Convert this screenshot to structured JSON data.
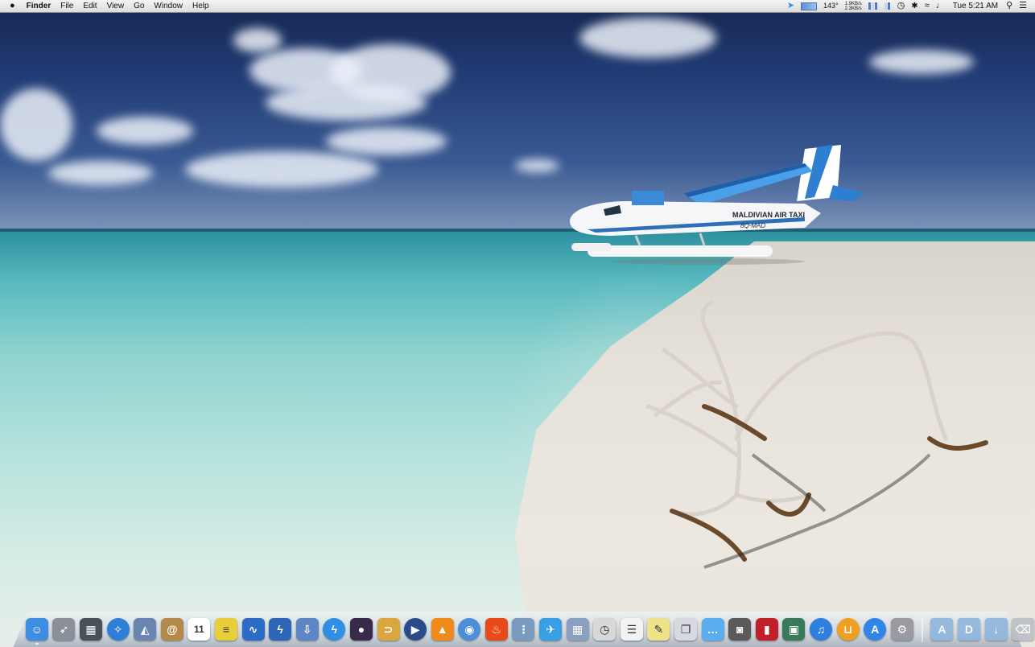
{
  "menubar": {
    "apple": "",
    "app_name": "Finder",
    "menus": [
      "File",
      "Edit",
      "View",
      "Go",
      "Window",
      "Help"
    ],
    "status": {
      "twitter_icon": "bird-icon",
      "temperature": "143°",
      "net_up": "1.9KB/s",
      "net_down": "2.3KB/s",
      "clock": "Tue 5:21 AM"
    }
  },
  "dock": {
    "apps": [
      {
        "name": "Finder",
        "icon": "finder-icon",
        "color": "#3d8de0"
      },
      {
        "name": "Launchpad",
        "icon": "rocket-icon",
        "color": "#8a8f99"
      },
      {
        "name": "Mission Control",
        "icon": "mission-control-icon",
        "color": "#4a5058"
      },
      {
        "name": "Safari",
        "icon": "compass-icon",
        "color": "#2f7fd8"
      },
      {
        "name": "Preview",
        "icon": "preview-icon",
        "color": "#6a86b0"
      },
      {
        "name": "Contacts",
        "icon": "address-book-icon",
        "color": "#b48a4a"
      },
      {
        "name": "Calendar",
        "icon": "calendar-icon",
        "color": "#ffffff",
        "label": "11"
      },
      {
        "name": "Stickies",
        "icon": "stickies-icon",
        "color": "#e8cf3a"
      },
      {
        "name": "Activity",
        "icon": "waveform-icon",
        "color": "#2c6cc9"
      },
      {
        "name": "Reeder",
        "icon": "lightning-bolt-icon",
        "color": "#2e66b8"
      },
      {
        "name": "Downloader",
        "icon": "download-tray-icon",
        "color": "#5f86c4"
      },
      {
        "name": "Sparrow",
        "icon": "bolt-circle-icon",
        "color": "#2f8fe6"
      },
      {
        "name": "Alfred",
        "icon": "bowler-hat-icon",
        "color": "#3a2a4a"
      },
      {
        "name": "Clipboard",
        "icon": "paperclip-icon",
        "color": "#d9a640"
      },
      {
        "name": "Media Player",
        "icon": "play-circle-icon",
        "color": "#2a4a8a"
      },
      {
        "name": "VLC",
        "icon": "traffic-cone-icon",
        "color": "#f08a1a"
      },
      {
        "name": "Chrome",
        "icon": "chrome-icon",
        "color": "#4a8fd8"
      },
      {
        "name": "Burn",
        "icon": "flame-icon",
        "color": "#e84a1a"
      },
      {
        "name": "Zipper",
        "icon": "zipper-icon",
        "color": "#7a9abf"
      },
      {
        "name": "Twitter",
        "icon": "bird-icon",
        "color": "#3aa0e6"
      },
      {
        "name": "Calendar Grid",
        "icon": "grid-icon",
        "color": "#8aa0c0"
      },
      {
        "name": "Clock",
        "icon": "clock-icon",
        "color": "#d8d8d8"
      },
      {
        "name": "TextEdit",
        "icon": "document-icon",
        "color": "#f2f2f2"
      },
      {
        "name": "Notes",
        "icon": "notepad-icon",
        "color": "#efe38a"
      },
      {
        "name": "Pages",
        "icon": "pages-icon",
        "color": "#d8d8e0"
      },
      {
        "name": "Messages",
        "icon": "speech-bubble-icon",
        "color": "#5aaef0"
      },
      {
        "name": "Photo Booth",
        "icon": "camera-icon",
        "color": "#5a5a5a"
      },
      {
        "name": "Photo Book",
        "icon": "red-book-icon",
        "color": "#c0202a"
      },
      {
        "name": "iPhoto",
        "icon": "photos-icon",
        "color": "#3a7a5a"
      },
      {
        "name": "iTunes",
        "icon": "music-note-icon",
        "color": "#2f7fe0"
      },
      {
        "name": "iBooks",
        "icon": "open-book-icon",
        "color": "#f0a020"
      },
      {
        "name": "App Store",
        "icon": "app-store-icon",
        "color": "#2f86e8"
      },
      {
        "name": "System Preferences",
        "icon": "gear-icon",
        "color": "#9a9aa0"
      }
    ],
    "stacks": [
      {
        "name": "Applications",
        "icon": "applications-folder-icon",
        "color": "#8ab4dc"
      },
      {
        "name": "Documents",
        "icon": "documents-folder-icon",
        "color": "#8ab4dc"
      },
      {
        "name": "Downloads",
        "icon": "downloads-folder-icon",
        "color": "#8ab4dc"
      },
      {
        "name": "Trash",
        "icon": "trash-icon",
        "color": "#b8bcc2"
      }
    ]
  },
  "wallpaper": {
    "plane_name": "MALDIVIAN AIR TAXI",
    "plane_reg": "8Q-MAD"
  }
}
